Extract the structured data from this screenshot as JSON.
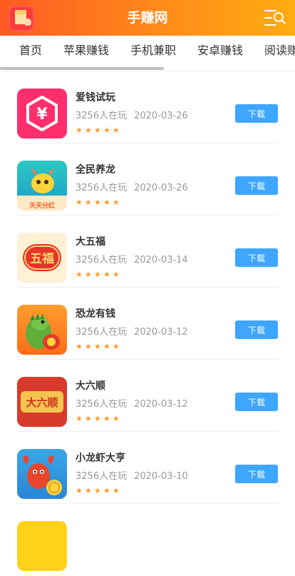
{
  "header": {
    "title": "手赚网"
  },
  "tabs": [
    {
      "label": "首页"
    },
    {
      "label": "苹果赚钱"
    },
    {
      "label": "手机兼职"
    },
    {
      "label": "安卓赚钱"
    },
    {
      "label": "阅读赚"
    }
  ],
  "apps": [
    {
      "name": "爱钱试玩",
      "players": "3256人在玩",
      "date": "2020-03-26",
      "rating": 5,
      "icon_label": "¥",
      "action": "下载"
    },
    {
      "name": "全民养龙",
      "players": "3256人在玩",
      "date": "2020-03-26",
      "rating": 5,
      "icon_label": "天天分红",
      "action": "下载"
    },
    {
      "name": "大五福",
      "players": "3256人在玩",
      "date": "2020-03-14",
      "rating": 5,
      "icon_label": "五福",
      "action": "下载"
    },
    {
      "name": "恐龙有钱",
      "players": "3256人在玩",
      "date": "2020-03-12",
      "rating": 5,
      "icon_label": "",
      "action": "下载"
    },
    {
      "name": "大六顺",
      "players": "3256人在玩",
      "date": "2020-03-12",
      "rating": 5,
      "icon_label": "大六顺",
      "action": "下载"
    },
    {
      "name": "小龙虾大亨",
      "players": "3256人在玩",
      "date": "2020-03-10",
      "rating": 5,
      "icon_label": "",
      "action": "下载"
    }
  ],
  "colors": {
    "header_start": "#ff5a22",
    "header_end": "#ffad10",
    "download_button": "#3ea6ff",
    "star": "#ff9a2e"
  },
  "icons": {
    "menu": "menu-search-icon",
    "logo": "red-envelope-logo"
  }
}
